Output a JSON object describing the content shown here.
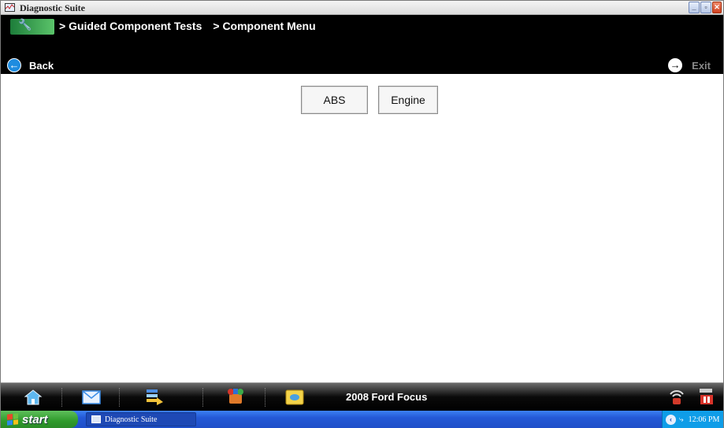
{
  "window": {
    "title": "Diagnostic Suite",
    "controls": [
      "minimize",
      "restore",
      "close"
    ]
  },
  "breadcrumb": {
    "items": [
      "> Guided Component Tests",
      "> Component Menu"
    ]
  },
  "nav": {
    "back_label": "Back",
    "exit_label": "Exit"
  },
  "menu": {
    "buttons": [
      {
        "label": "ABS"
      },
      {
        "label": "Engine"
      }
    ]
  },
  "toolbar": {
    "vehicle": "2008 Ford Focus",
    "icons": [
      "home-icon",
      "email-icon",
      "tasks-icon",
      "plugin-icon",
      "data-icon",
      "wireless-icon",
      "battery-icon"
    ]
  },
  "taskbar": {
    "start_label": "start",
    "task_label": "Diagnostic Suite",
    "clock": "12:06 PM"
  },
  "colors": {
    "header_bg": "#000000",
    "taskbar_blue": "#245edb",
    "start_green": "#3c9c37",
    "accent_blue": "#1e8ce0"
  }
}
